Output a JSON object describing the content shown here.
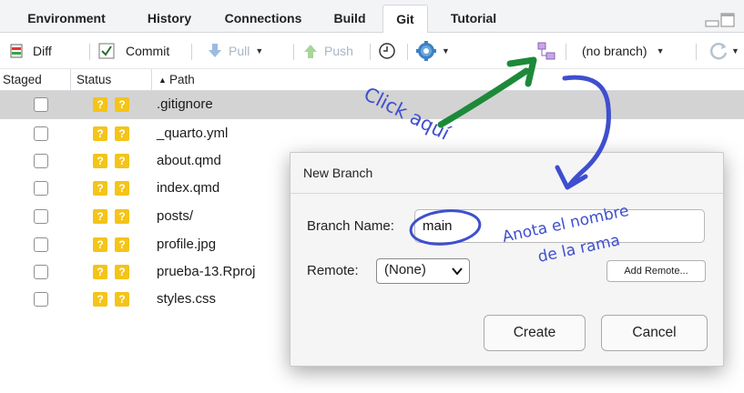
{
  "tabs": [
    "Environment",
    "History",
    "Connections",
    "Build",
    "Git",
    "Tutorial"
  ],
  "active_tab": "Git",
  "toolbar": {
    "diff_label": "Diff",
    "commit_label": "Commit",
    "pull_label": "Pull",
    "push_label": "Push",
    "branch_label": "(no branch)"
  },
  "columns": {
    "staged": "Staged",
    "status": "Status",
    "path": "Path"
  },
  "files": [
    {
      "name": ".gitignore",
      "status": [
        "?",
        "?"
      ],
      "selected": true
    },
    {
      "name": "_quarto.yml",
      "status": [
        "?",
        "?"
      ]
    },
    {
      "name": "about.qmd",
      "status": [
        "?",
        "?"
      ]
    },
    {
      "name": "index.qmd",
      "status": [
        "?",
        "?"
      ]
    },
    {
      "name": "posts/",
      "status": [
        "?",
        "?"
      ]
    },
    {
      "name": "profile.jpg",
      "status": [
        "?",
        "?"
      ]
    },
    {
      "name": "prueba-13.Rproj",
      "status": [
        "?",
        "?"
      ]
    },
    {
      "name": "styles.css",
      "status": [
        "?",
        "?"
      ]
    }
  ],
  "dialog": {
    "title": "New Branch",
    "branch_name_label": "Branch Name:",
    "branch_name_value": "main",
    "remote_label": "Remote:",
    "remote_value": "(None)",
    "add_remote_label": "Add Remote...",
    "create_label": "Create",
    "cancel_label": "Cancel"
  },
  "annotations": {
    "click_here": "Click aquí",
    "note_line1": "Anota el nombre",
    "note_line2": "de la rama"
  },
  "colors": {
    "status_badge": "#f4c418",
    "annotation_blue": "#3e4fcf",
    "annotation_green": "#1c8a3a",
    "selected_row": "#d3d3d3"
  }
}
